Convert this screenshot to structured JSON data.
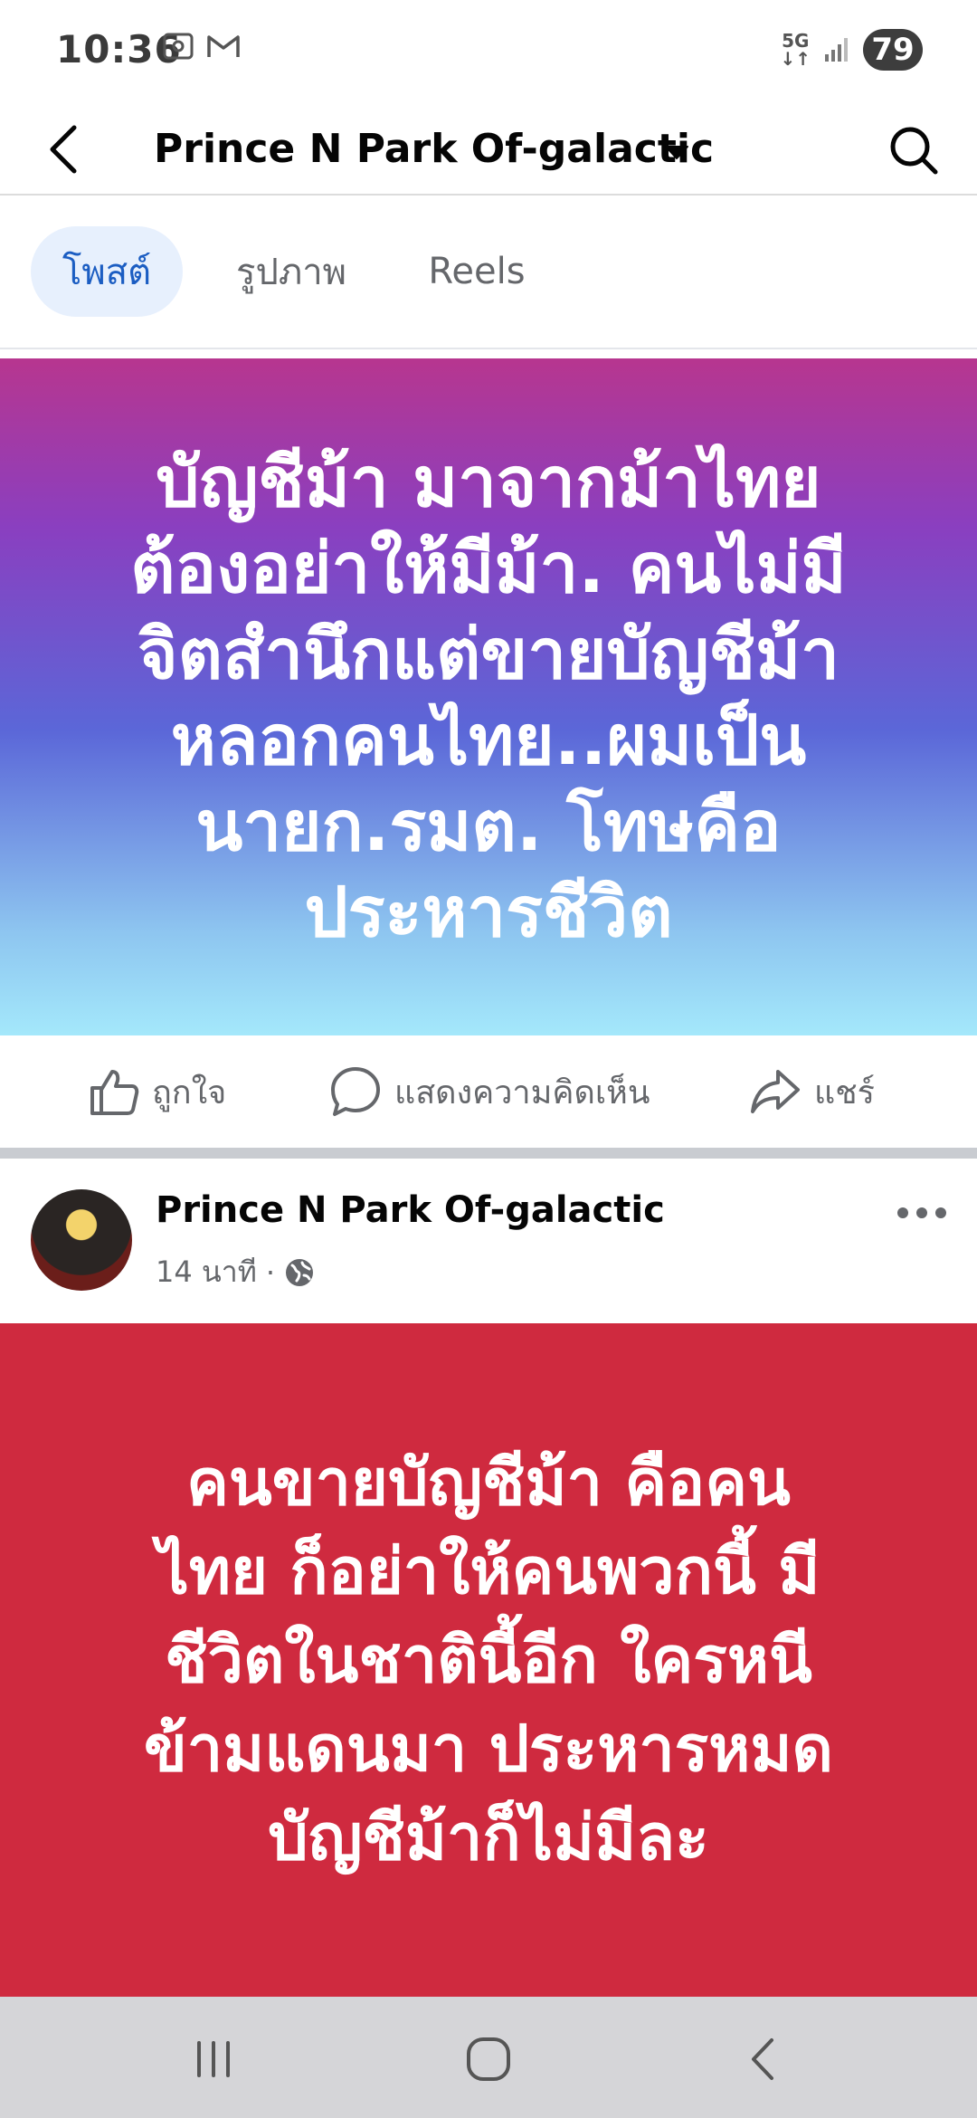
{
  "status_bar": {
    "time": "10:36",
    "network_top": "5G",
    "network_bottom": "↓↑",
    "battery": "79"
  },
  "header": {
    "title": "Prince N Park Of-galactic",
    "icons": [
      "back-arrow-icon",
      "dropdown-caret-icon",
      "search-icon"
    ]
  },
  "tabs": [
    {
      "label": "โพสต์",
      "active": true
    },
    {
      "label": "รูปภาพ",
      "active": false
    },
    {
      "label": "Reels",
      "active": false
    }
  ],
  "post1": {
    "text": "บัญชีม้า มาจากม้าไทย\nต้องอย่าให้มีม้า. คนไม่มี\nจิตสำนึกแต่ขายบัญชีม้า\nหลอกคนไทย..ผมเป็น\nนายก.รมต. โทษคือ\nประหารชีวิต",
    "actions": {
      "like": "ถูกใจ",
      "comment": "แสดงความคิดเห็น",
      "share": "แชร์"
    }
  },
  "post2": {
    "author": "Prince N Park Of-galactic",
    "time": "14 นาที",
    "separator": "·",
    "audience_icon": "globe-icon",
    "text": "คนขายบัญชีม้า คือคน\nไทย ก็อย่าให้คนพวกนี้ มี\nชีวิตในชาตินี้อีก ใครหนี\nข้ามแดนมา ประหารหมด\nบัญชีม้าก็ไม่มีละ"
  },
  "navbar": {
    "icons": [
      "recent-apps-icon",
      "home-icon",
      "back-icon"
    ]
  },
  "colors": {
    "post2_background": "#cf2a3f",
    "active_tab": "#1b5dc2",
    "active_tab_bg": "#e7f0fd"
  }
}
